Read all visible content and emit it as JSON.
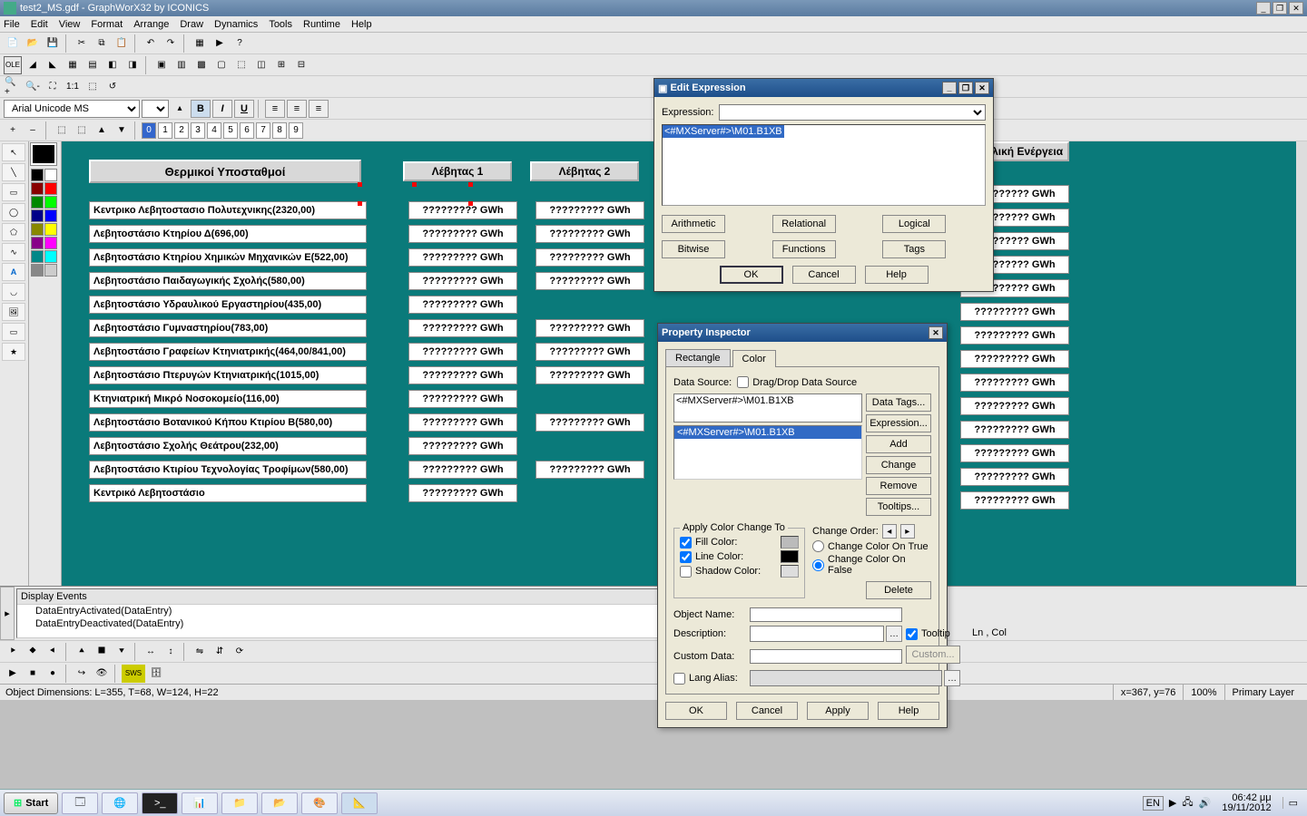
{
  "title": "test2_MS.gdf - GraphWorX32 by ICONICS",
  "menu": [
    "File",
    "Edit",
    "View",
    "Format",
    "Arrange",
    "Draw",
    "Dynamics",
    "Tools",
    "Runtime",
    "Help"
  ],
  "font": {
    "name": "Arial Unicode MS",
    "size": "8"
  },
  "layers": [
    "0",
    "1",
    "2",
    "3",
    "4",
    "5",
    "6",
    "7",
    "8",
    "9"
  ],
  "hmi": {
    "main_header": "Θερμικοί Υποσταθμοί",
    "col1": "Λέβητας 1",
    "col2": "Λέβητας 2",
    "col_total": "Συνολική Ενέργεια",
    "placeholder": "????????? GWh",
    "stations": [
      "Κεντρικο Λεβητοστασιο Πολυτεχνικης(2320,00)",
      "Λεβητοστάσιο Κτηρίου Δ(696,00)",
      "Λεβητοστάσιο Κτηρίου Χημικών Μηχανικών Ε(522,00)",
      "Λεβητοστάσιο Παιδαγωγικής Σχολής(580,00)",
      "Λεβητοστάσιο Υδραυλικού Εργαστηρίου(435,00)",
      "Λεβητοστάσιο Γυμναστηρίου(783,00)",
      "Λεβητοστάσιο Γραφείων Κτηνιατρικής(464,00/841,00)",
      "Λεβητοστάσιο Πτερυγών Κτηνιατρικής(1015,00)",
      "Κτηνιατρική Μικρό Νοσοκομείο(116,00)",
      "Λεβητοστάσιο Βοτανικού Κήπου Κτιρίου Β(580,00)",
      "Λεβητοστάσιο Σχολής Θεάτρου(232,00)",
      "Λεβητοστάσιο Κτιρίου Τεχνολογίας Τροφίμων(580,00)",
      "Κεντρικό Λεβητοστάσιο"
    ],
    "total_row": "????????? GWh"
  },
  "events": {
    "header": "Display Events",
    "rows": [
      "DataEntryActivated(DataEntry)",
      "DataEntryDeactivated(DataEntry)"
    ],
    "lncol": "Ln , Col"
  },
  "status": {
    "dims": "Object Dimensions: L=355, T=68, W=124, H=22",
    "xy": "x=367, y=76",
    "zoom": "100%",
    "layer": "Primary Layer"
  },
  "edit_expr": {
    "title": "Edit Expression",
    "label": "Expression:",
    "value": "<#MXServer#>\\M01.B1XB",
    "btns": [
      "Arithmetic",
      "Relational",
      "Logical",
      "Bitwise",
      "Functions",
      "Tags"
    ],
    "ok": "OK",
    "cancel": "Cancel",
    "help": "Help"
  },
  "prop_insp": {
    "title": "Property Inspector",
    "tabs": [
      "Rectangle",
      "Color"
    ],
    "ds_label": "Data Source:",
    "dragdrop": "Drag/Drop Data Source",
    "ds_value": "<#MXServer#>\\M01.B1XB",
    "list_sel": "<#MXServer#>\\M01.B1XB",
    "side_btns": [
      "Data Tags...",
      "Expression...",
      "Add",
      "Change",
      "Remove",
      "Tooltips..."
    ],
    "apply_group": "Apply Color Change To",
    "fill": "Fill Color:",
    "line": "Line Color:",
    "shadow": "Shadow Color:",
    "order": "Change Order:",
    "on_true": "Change Color On True",
    "on_false": "Change Color On False",
    "delete": "Delete",
    "objname": "Object Name:",
    "desc": "Description:",
    "custom": "Custom Data:",
    "custom_btn": "Custom...",
    "tooltip": "Tooltip",
    "lang": "Lang Alias:",
    "ok": "OK",
    "cancel": "Cancel",
    "apply": "Apply",
    "help": "Help"
  },
  "taskbar": {
    "start": "Start",
    "lang": "EN",
    "time": "06:42 μμ",
    "date": "19/11/2012"
  }
}
